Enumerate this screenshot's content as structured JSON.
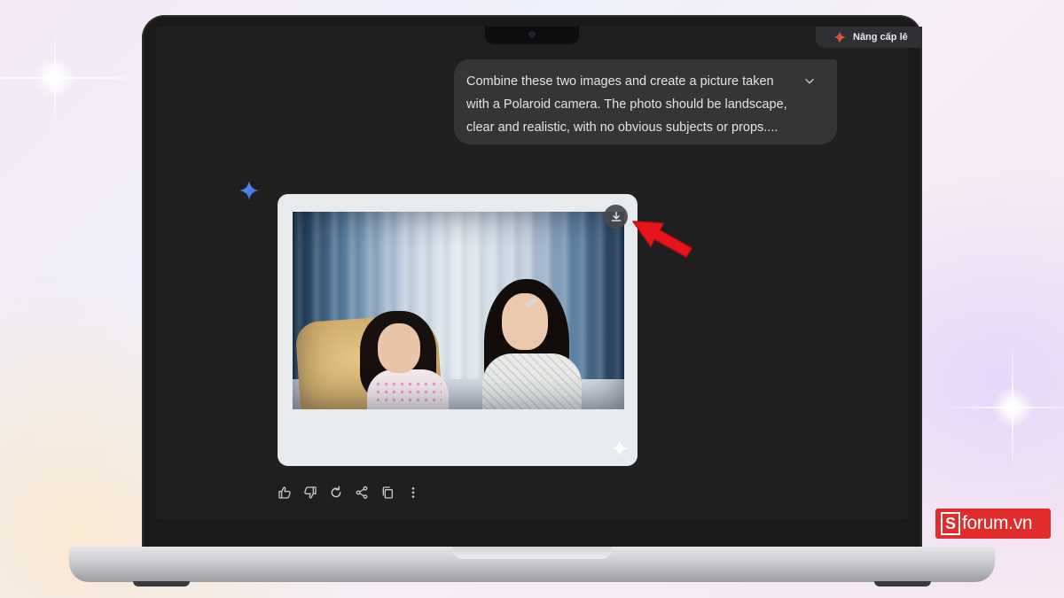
{
  "header": {
    "upgrade_label": "Nâng cấp lê",
    "upgrade_icon": "gemini-spark-icon"
  },
  "conversation": {
    "user_prompt": {
      "text": "Combine these two images and create a picture taken with a Polaroid camera. The photo should be landscape, clear and realistic, with no obvious subjects or props....",
      "expand_icon": "chevron-down-icon"
    },
    "response": {
      "avatar_icon": "gemini-spark-icon",
      "image": {
        "description_icon": "polaroid-photo",
        "download_icon": "download-icon",
        "corner_icon": "sparkle-icon"
      },
      "actions": [
        {
          "name": "thumbs-up",
          "icon": "thumbs-up-icon"
        },
        {
          "name": "thumbs-down",
          "icon": "thumbs-down-icon"
        },
        {
          "name": "regenerate",
          "icon": "refresh-icon"
        },
        {
          "name": "share",
          "icon": "share-icon"
        },
        {
          "name": "copy",
          "icon": "copy-icon"
        },
        {
          "name": "more",
          "icon": "more-vert-icon"
        }
      ]
    }
  },
  "annotation": {
    "arrow_color": "#e8141c"
  },
  "watermark": {
    "logo_letter": "S",
    "text": "forum.vn",
    "color": "#e22b2b"
  }
}
